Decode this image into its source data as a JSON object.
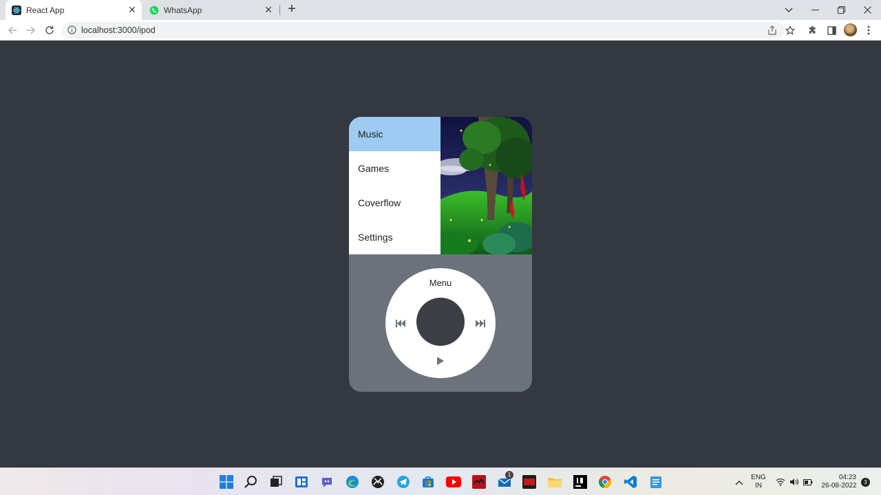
{
  "browser": {
    "tabs": [
      {
        "title": "React App",
        "active": true
      },
      {
        "title": "WhatsApp",
        "active": false
      }
    ],
    "url": "localhost:3000/ipod"
  },
  "ipod": {
    "menu_items": [
      "Music",
      "Games",
      "Coverflow",
      "Settings"
    ],
    "selected_item": "Music",
    "wheel": {
      "menu_label": "Menu"
    },
    "colors": {
      "body": "#6b727b",
      "selected": "#9ecbf2",
      "center_button": "#3c3f45",
      "page_bg": "#343841"
    }
  },
  "taskbar": {
    "language": "ENG",
    "region": "IN",
    "time": "04:23",
    "date": "26-08-2022",
    "notification_count": "3",
    "mail_badge": "1"
  }
}
